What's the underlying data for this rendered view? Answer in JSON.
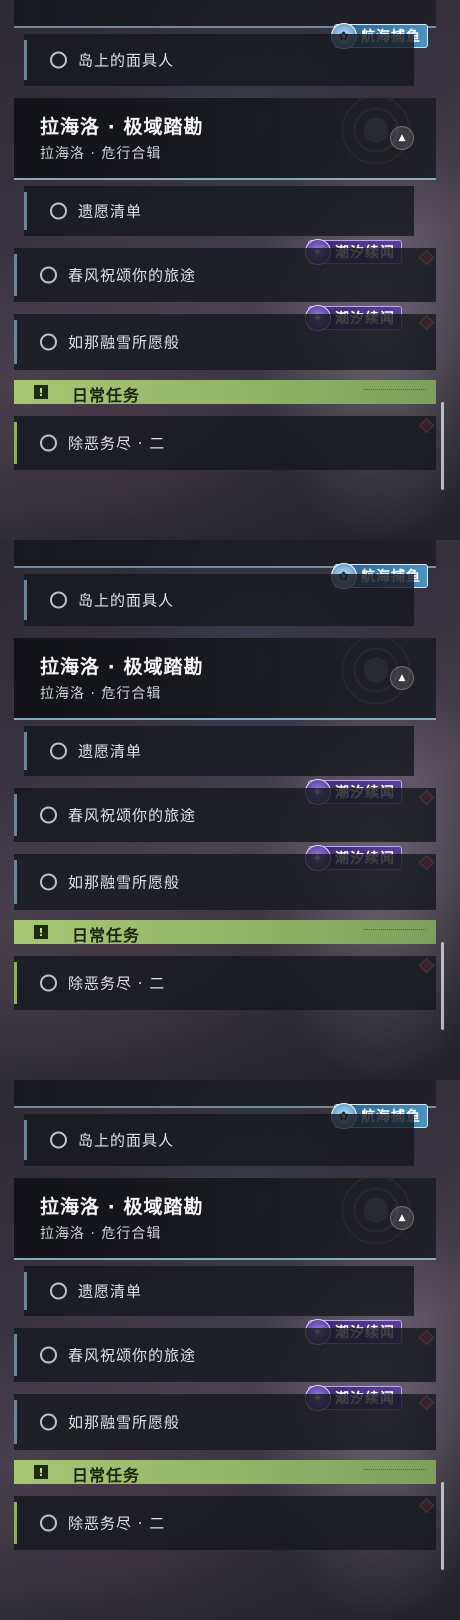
{
  "panels": [
    {
      "sea_tag": "航海捕鱼",
      "mask_quest": "岛上的面具人",
      "header_title": "拉海洛 · 极域踏勘",
      "header_subtitle": "拉海洛 · 危行合辑",
      "wish_list": "遗愿清单",
      "quest_spring": "春风祝颂你的旅途",
      "quest_snow": "如那融雪所愿般",
      "tide_tag": "潮汐续闻",
      "daily_label": "日常任务",
      "daily_quest": "除恶务尽 · 二"
    },
    {
      "sea_tag": "航海捕鱼",
      "mask_quest": "岛上的面具人",
      "header_title": "拉海洛 · 极域踏勘",
      "header_subtitle": "拉海洛 · 危行合辑",
      "wish_list": "遗愿清单",
      "quest_spring": "春风祝颂你的旅途",
      "quest_snow": "如那融雪所愿般",
      "tide_tag": "潮汐续闻",
      "daily_label": "日常任务",
      "daily_quest": "除恶务尽 · 二"
    },
    {
      "sea_tag": "航海捕鱼",
      "mask_quest": "岛上的面具人",
      "header_title": "拉海洛 · 极域踏勘",
      "header_subtitle": "拉海洛 · 危行合辑",
      "wish_list": "遗愿清单",
      "quest_spring": "春风祝颂你的旅途",
      "quest_snow": "如那融雪所愿般",
      "tide_tag": "潮汐续闻",
      "daily_label": "日常任务",
      "daily_quest": "除恶务尽 · 二"
    }
  ],
  "colors": {
    "tide_tag": "#5a3f9a",
    "sea_tag": "#4c93c0",
    "daily_bar": "#a6c774",
    "alert_diamond": "#d9445a",
    "header_accent": "#a0d2e6"
  },
  "icons": {
    "quest_status": "hollow-circle-icon",
    "collapse": "triangle-up-icon",
    "daily": "exclamation-icon",
    "alert": "diamond-icon",
    "tide_badge": "swirl-emblem-icon",
    "sea_badge": "fishing-emblem-icon"
  }
}
